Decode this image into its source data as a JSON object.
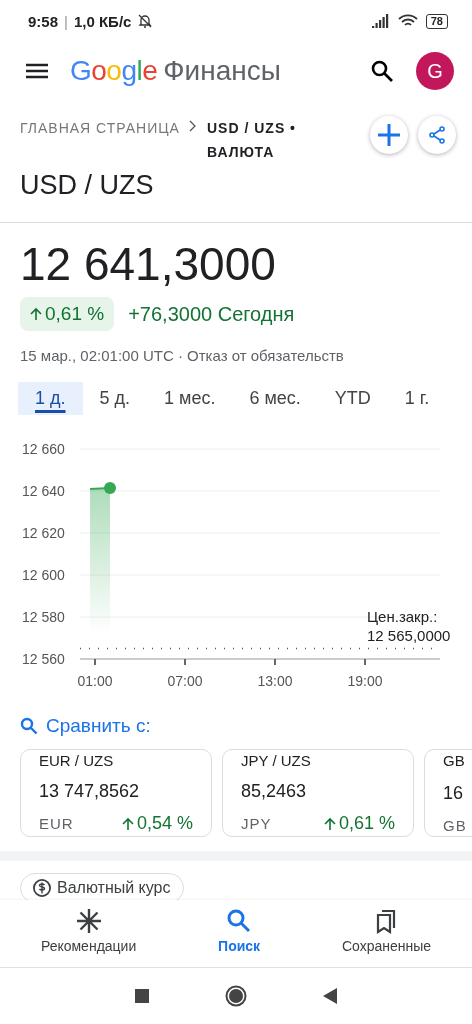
{
  "status_bar": {
    "time": "9:58",
    "separator": "|",
    "speed": "1,0 КБ/с",
    "battery": "78"
  },
  "app_bar": {
    "logo": "Google",
    "product": "Финансы",
    "avatar": "G"
  },
  "breadcrumb": {
    "home": "ГЛАВНАЯ СТРАНИЦА",
    "current": "USD / UZS • ВАЛЮТА"
  },
  "title": "USD / UZS",
  "price": "12 641,3000",
  "change": {
    "percent": "0,61 %",
    "absolute": "+76,3000 Сегодня"
  },
  "timestamp": "15 мар., 02:01:00 UTC · Отказ от обязательств",
  "range_tabs": [
    {
      "label": "1 д.",
      "selected": true
    },
    {
      "label": "5 д.",
      "selected": false
    },
    {
      "label": "1 мес.",
      "selected": false
    },
    {
      "label": "6 мес.",
      "selected": false
    },
    {
      "label": "YTD",
      "selected": false
    },
    {
      "label": "1 г.",
      "selected": false
    }
  ],
  "chart": {
    "chart_data": {
      "type": "area",
      "x": [
        0.67,
        2
      ],
      "grid": true,
      "series": [
        {
          "color": "#34a853",
          "values": [
            12641,
            12641.4
          ]
        }
      ],
      "xlim": [
        0,
        24
      ],
      "ylim": [
        12560,
        12660
      ],
      "xticks": [
        {
          "value": 1,
          "label": "01:00"
        },
        {
          "value": 7,
          "label": "07:00"
        },
        {
          "value": 13,
          "label": "13:00"
        },
        {
          "value": 19,
          "label": "19:00"
        }
      ],
      "yticks": [
        {
          "value": 12560,
          "label": "12 560"
        },
        {
          "value": 12580,
          "label": "12 580"
        },
        {
          "value": 12600,
          "label": "12 600"
        },
        {
          "value": 12620,
          "label": "12 620"
        },
        {
          "value": 12640,
          "label": "12 640"
        },
        {
          "value": 12660,
          "label": "12 660"
        }
      ],
      "ref_lines": [
        {
          "axis": "y",
          "value": 12565
        }
      ],
      "annotations": [
        "Цен.закр.:",
        "12 565,0000"
      ]
    }
  },
  "compare": {
    "title": "Сравнить с:",
    "cards": [
      {
        "pair": "EUR / UZS",
        "value": "13 747,8562",
        "currency": "EUR",
        "change": "0,54 %"
      },
      {
        "pair": "JPY / UZS",
        "value": "85,2463",
        "currency": "JPY",
        "change": "0,61 %"
      },
      {
        "pair": "GB",
        "value": "16",
        "currency": "GB"
      }
    ]
  },
  "chip": "Валютный курс",
  "bottom_nav": [
    {
      "label": "Рекомендации",
      "selected": false
    },
    {
      "label": "Поиск",
      "selected": true
    },
    {
      "label": "Сохраненные",
      "selected": false
    }
  ]
}
